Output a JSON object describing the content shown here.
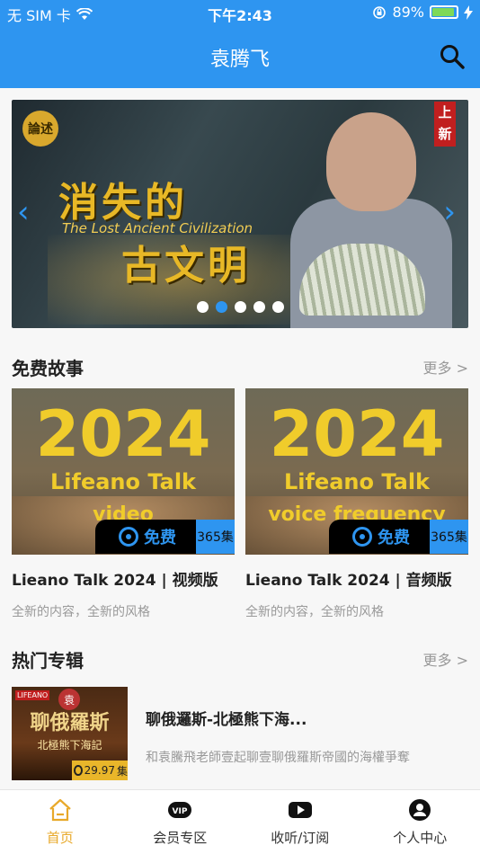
{
  "status_bar": {
    "carrier": "无 SIM 卡",
    "time": "下午2:43",
    "battery": "89%",
    "battery_level": 0.89
  },
  "header": {
    "title": "袁腾飞"
  },
  "banner": {
    "logo_text": "論述",
    "new_tag": "上新",
    "title_line1": "消失的",
    "title_en": "The Lost Ancient Civilization",
    "title_line2": "古文明",
    "active_dot": 2,
    "dot_count": 5
  },
  "free_stories": {
    "heading": "免费故事",
    "more": "更多 >",
    "items": [
      {
        "year": "2024",
        "talk": "Lifeano Talk",
        "sub": "video",
        "free_label": "免费",
        "episodes": "365集",
        "title": "Lieano Talk 2024 | 视频版",
        "desc": "全新的内容，全新的风格"
      },
      {
        "year": "2024",
        "talk": "Lifeano Talk",
        "sub": "voice frequency",
        "free_label": "免费",
        "episodes": "365集",
        "title": "Lieano Talk 2024 | 音频版",
        "desc": "全新的内容，全新的风格"
      }
    ]
  },
  "hot_albums": {
    "heading": "热门专辑",
    "more": "更多 >",
    "items": [
      {
        "cover_tag": "LIFEANO",
        "cover_seal": "袁",
        "cover_title": "聊俄羅斯",
        "cover_sub": "北極熊下海記",
        "play_count": "29.97",
        "episodes": "集",
        "title": "聊俄邏斯-北極熊下海...",
        "desc": "和袁騰飛老師壹起聊壹聊俄羅斯帝國的海權爭奪"
      }
    ]
  },
  "tab_bar": {
    "tabs": [
      {
        "label": "首页",
        "icon": "home-icon",
        "active": true
      },
      {
        "label": "会员专区",
        "icon": "vip-icon",
        "active": false
      },
      {
        "label": "收听/订阅",
        "icon": "play-icon",
        "active": false
      },
      {
        "label": "个人中心",
        "icon": "user-icon",
        "active": false
      }
    ]
  },
  "colors": {
    "primary": "#2e95f0",
    "active_tab": "#e8a92a",
    "gold": "#f0cc2b"
  }
}
